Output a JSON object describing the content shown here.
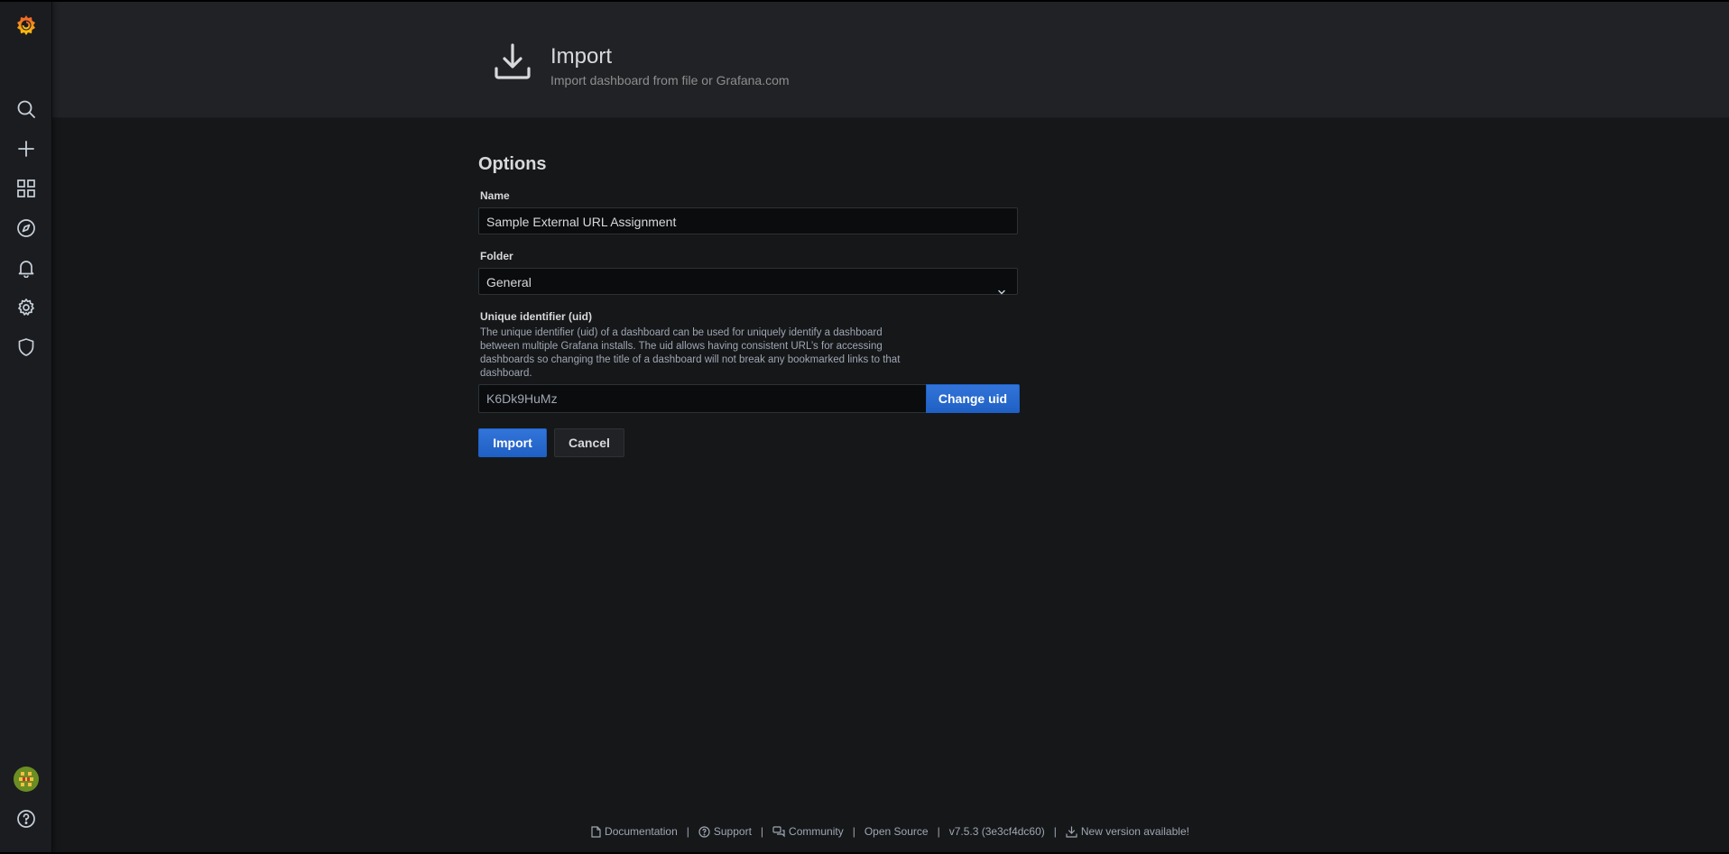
{
  "header": {
    "title": "Import",
    "subtitle": "Import dashboard from file or Grafana.com"
  },
  "sidebar": {
    "items": [
      {
        "icon": "grafana-logo"
      },
      {
        "icon": "search-icon"
      },
      {
        "icon": "plus-icon"
      },
      {
        "icon": "dashboards-grid-icon"
      },
      {
        "icon": "compass-icon"
      },
      {
        "icon": "bell-icon"
      },
      {
        "icon": "gear-icon"
      },
      {
        "icon": "shield-icon"
      },
      {
        "icon": "user-avatar"
      },
      {
        "icon": "help-icon"
      }
    ]
  },
  "options": {
    "title": "Options",
    "name_label": "Name",
    "name_value": "Sample External URL Assignment",
    "folder_label": "Folder",
    "folder_value": "General",
    "uid_label": "Unique identifier (uid)",
    "uid_description": "The unique identifier (uid) of a dashboard can be used for uniquely identify a dashboard between multiple Grafana installs. The uid allows having consistent URL’s for accessing dashboards so changing the title of a dashboard will not break any bookmarked links to that dashboard.",
    "uid_value": "K6Dk9HuMz",
    "change_uid_label": "Change uid",
    "import_label": "Import",
    "cancel_label": "Cancel"
  },
  "footer": {
    "documentation": "Documentation",
    "support": "Support",
    "community": "Community",
    "open_source": "Open Source",
    "version": "v7.5.3 (3e3cf4dc60)",
    "new_version": "New version available!",
    "separator": "|"
  },
  "colors": {
    "accent": "#3274d9",
    "background": "#161719",
    "header_bg": "#212226",
    "logo_orange": "#f46800"
  }
}
